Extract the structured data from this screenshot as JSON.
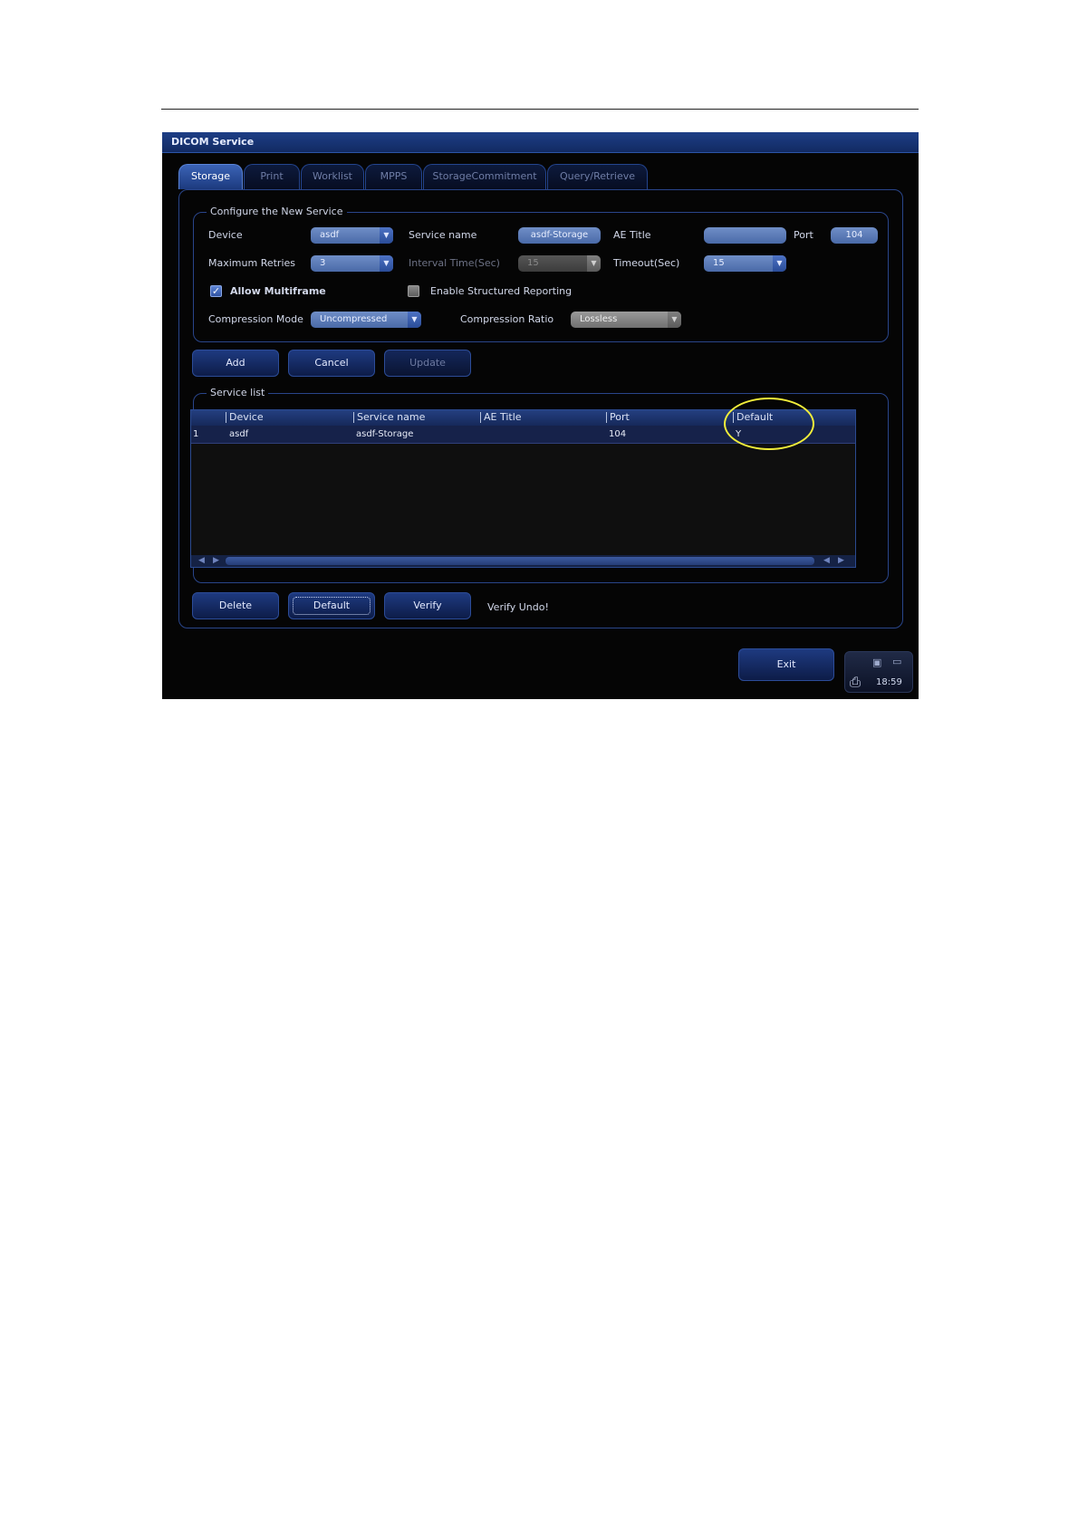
{
  "window": {
    "title": "DICOM Service"
  },
  "tabs": [
    {
      "label": "Storage",
      "active": true
    },
    {
      "label": "Print",
      "active": false
    },
    {
      "label": "Worklist",
      "active": false
    },
    {
      "label": "MPPS",
      "active": false
    },
    {
      "label": "StorageCommitment",
      "active": false
    },
    {
      "label": "Query/Retrieve",
      "active": false
    }
  ],
  "config": {
    "legend": "Configure the New Service",
    "device_label": "Device",
    "device_value": "asdf",
    "service_name_label": "Service name",
    "service_name_value": "asdf-Storage",
    "ae_title_label": "AE Title",
    "ae_title_value": "",
    "port_label": "Port",
    "port_value": "104",
    "max_retries_label": "Maximum Retries",
    "max_retries_value": "3",
    "interval_label": "Interval Time(Sec)",
    "interval_value": "15",
    "timeout_label": "Timeout(Sec)",
    "timeout_value": "15",
    "allow_multiframe_label": "Allow Multiframe",
    "allow_multiframe_checked": true,
    "structured_reporting_label": "Enable Structured Reporting",
    "structured_reporting_checked": false,
    "compression_mode_label": "Compression Mode",
    "compression_mode_value": "Uncompressed",
    "compression_ratio_label": "Compression Ratio",
    "compression_ratio_value": "Lossless"
  },
  "actions": {
    "add": "Add",
    "cancel": "Cancel",
    "update": "Update"
  },
  "service_list": {
    "legend": "Service list",
    "columns": [
      "Device",
      "Service name",
      "AE Title",
      "Port",
      "Default"
    ],
    "rows": [
      {
        "index": "1",
        "device": "asdf",
        "service_name": "asdf-Storage",
        "ae_title": "",
        "port": "104",
        "default": "Y"
      }
    ]
  },
  "bottom_actions": {
    "delete": "Delete",
    "default": "Default",
    "verify": "Verify",
    "verify_status": "Verify Undo!"
  },
  "footer": {
    "exit": "Exit",
    "time": "18:59"
  },
  "colors": {
    "accent": "#3b63b6",
    "highlight": "#f2ee3a",
    "background": "#050505"
  }
}
